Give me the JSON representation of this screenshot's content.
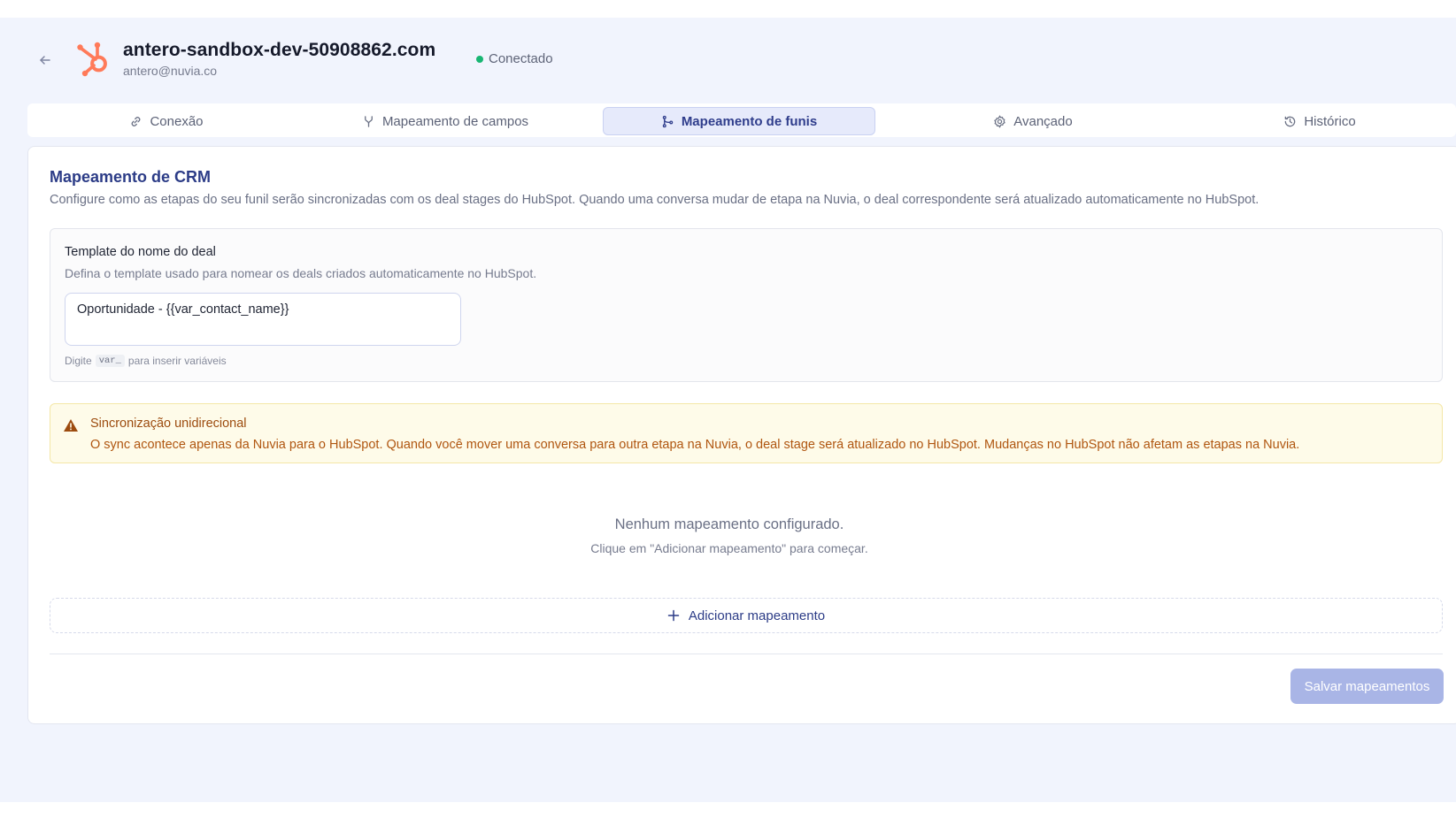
{
  "header": {
    "title": "antero-sandbox-dev-50908862.com",
    "email": "antero@nuvia.co",
    "status": "Conectado",
    "logo": "hubspot-logo",
    "status_color": "#18b673"
  },
  "tabs": [
    {
      "label": "Conexão",
      "icon": "link-icon"
    },
    {
      "label": "Mapeamento de campos",
      "icon": "merge-icon"
    },
    {
      "label": "Mapeamento de funis",
      "icon": "branch-icon",
      "active": true
    },
    {
      "label": "Avançado",
      "icon": "gear-icon"
    },
    {
      "label": "Histórico",
      "icon": "history-icon"
    }
  ],
  "panel": {
    "title": "Mapeamento de CRM",
    "description": "Configure como as etapas do seu funil serão sincronizadas com os deal stages do HubSpot. Quando uma conversa mudar de etapa na Nuvia, o deal correspondente será atualizado automaticamente no HubSpot."
  },
  "template": {
    "label": "Template do nome do deal",
    "help": "Defina o template usado para nomear os deals criados automaticamente no HubSpot.",
    "value": "Oportunidade - {{var_contact_name}}",
    "hint_prefix": "Digite",
    "hint_code": "var_",
    "hint_suffix": "para inserir variáveis"
  },
  "warning": {
    "title": "Sincronização unidirecional",
    "text": "O sync acontece apenas da Nuvia para o HubSpot. Quando você mover uma conversa para outra etapa na Nuvia, o deal stage será atualizado no HubSpot. Mudanças no HubSpot não afetam as etapas na Nuvia."
  },
  "empty": {
    "title": "Nenhum mapeamento configurado.",
    "subtitle": "Clique em \"Adicionar mapeamento\" para começar."
  },
  "actions": {
    "add_label": "Adicionar mapeamento",
    "save_label": "Salvar mapeamentos"
  },
  "colors": {
    "accent": "#2c3c87",
    "hubspot_orange": "#ff7a59",
    "warning_text": "#b05610",
    "save_disabled": "#a9b5e6"
  }
}
